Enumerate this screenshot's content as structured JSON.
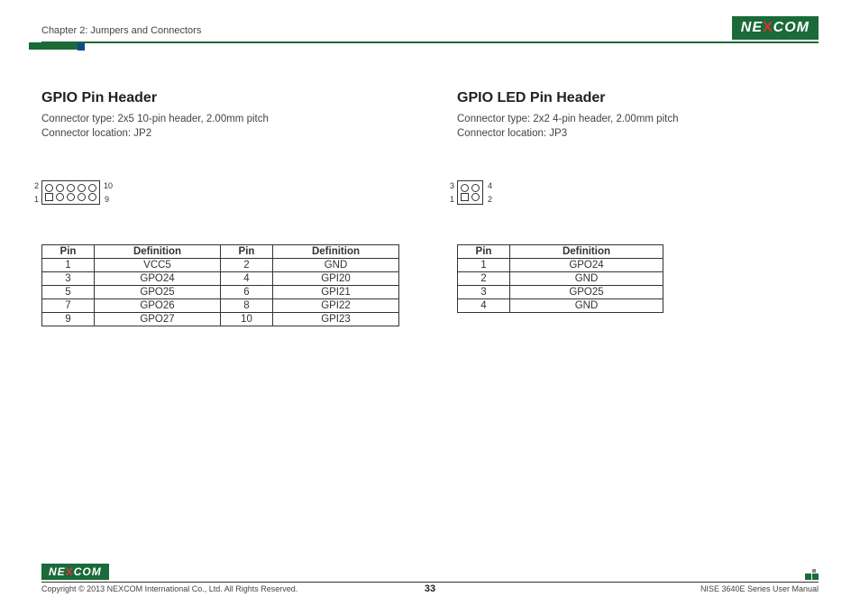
{
  "header": {
    "chapter": "Chapter 2: Jumpers and Connectors",
    "logo_pre": "NE",
    "logo_x": "X",
    "logo_post": "COM"
  },
  "left": {
    "title": "GPIO Pin Header",
    "conn_type": "Connector type: 2x5 10-pin header, 2.00mm pitch",
    "conn_loc": "Connector location: JP2",
    "labels": {
      "tl": "2",
      "tr": "10",
      "bl": "1",
      "br": "9"
    },
    "th": [
      "Pin",
      "Definition",
      "Pin",
      "Definition"
    ],
    "rows": [
      [
        "1",
        "VCC5",
        "2",
        "GND"
      ],
      [
        "3",
        "GPO24",
        "4",
        "GPI20"
      ],
      [
        "5",
        "GPO25",
        "6",
        "GPI21"
      ],
      [
        "7",
        "GPO26",
        "8",
        "GPI22"
      ],
      [
        "9",
        "GPO27",
        "10",
        "GPI23"
      ]
    ]
  },
  "right": {
    "title": "GPIO LED Pin Header",
    "conn_type": "Connector type: 2x2 4-pin header, 2.00mm pitch",
    "conn_loc": "Connector location: JP3",
    "labels": {
      "tl": "3",
      "tr": "4",
      "bl": "1",
      "br": "2"
    },
    "th": [
      "Pin",
      "Definition"
    ],
    "rows": [
      [
        "1",
        "GPO24"
      ],
      [
        "2",
        "GND"
      ],
      [
        "3",
        "GPO25"
      ],
      [
        "4",
        "GND"
      ]
    ]
  },
  "footer": {
    "copyright": "Copyright © 2013 NEXCOM International Co., Ltd. All Rights Reserved.",
    "page": "33",
    "manual": "NISE 3640E Series User Manual"
  }
}
